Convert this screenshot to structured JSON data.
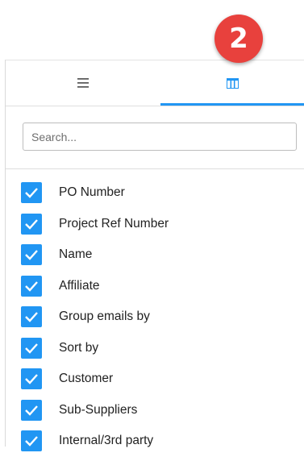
{
  "step_badge": "2",
  "tabs": [
    {
      "name": "general-menu",
      "icon": "hamburger-menu-icon",
      "active": false
    },
    {
      "name": "columns",
      "icon": "columns-icon",
      "active": true
    }
  ],
  "colors": {
    "accent": "#2196f3",
    "badge": "#e8413d"
  },
  "search": {
    "placeholder": "Search...",
    "value": ""
  },
  "columns": [
    {
      "label": "PO Number",
      "checked": true
    },
    {
      "label": "Project Ref Number",
      "checked": true
    },
    {
      "label": "Name",
      "checked": true
    },
    {
      "label": "Affiliate",
      "checked": true
    },
    {
      "label": "Group emails by",
      "checked": true
    },
    {
      "label": "Sort by",
      "checked": true
    },
    {
      "label": "Customer",
      "checked": true
    },
    {
      "label": "Sub-Suppliers",
      "checked": true
    },
    {
      "label": "Internal/3rd party",
      "checked": true
    }
  ]
}
